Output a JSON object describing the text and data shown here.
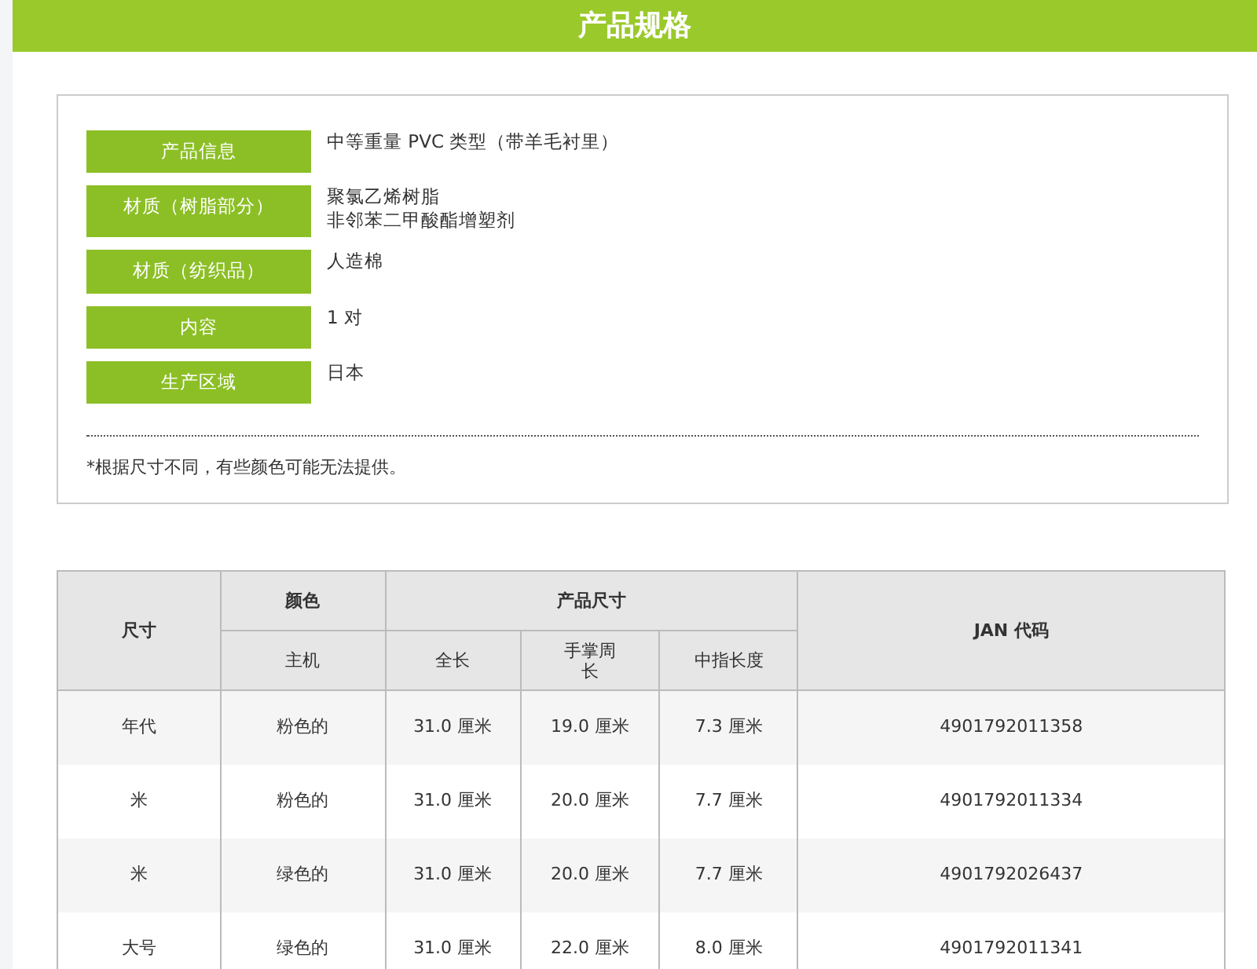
{
  "header": {
    "title": "产品规格"
  },
  "specs": [
    {
      "label": "产品信息",
      "lines": [
        "中等重量 PVC 类型（带羊毛衬里）"
      ]
    },
    {
      "label": "材质（树脂部分）",
      "lines": [
        "聚氯乙烯树脂",
        "非邻苯二甲酸酯增塑剂"
      ]
    },
    {
      "label": "材质（纺织品）",
      "lines": [
        "人造棉"
      ]
    },
    {
      "label": "内容",
      "lines": [
        "1 对"
      ]
    },
    {
      "label": "生产区域",
      "lines": [
        "日本"
      ]
    }
  ],
  "note": "*根据尺寸不同，有些颜色可能无法提供。",
  "table": {
    "groups": [
      {
        "label": "尺寸"
      },
      {
        "label": "颜色",
        "columns": [
          "主机"
        ]
      },
      {
        "label": "产品尺寸",
        "columns": [
          "全长",
          "手掌周长",
          "中指长度"
        ]
      },
      {
        "label": "JAN 代码"
      }
    ],
    "rows": [
      [
        "年代",
        "粉色的",
        "31.0 厘米",
        "19.0 厘米",
        "7.3 厘米",
        "4901792011358"
      ],
      [
        "米",
        "粉色的",
        "31.0 厘米",
        "20.0 厘米",
        "7.7 厘米",
        "4901792011334"
      ],
      [
        "米",
        "绿色的",
        "31.0 厘米",
        "20.0 厘米",
        "7.7 厘米",
        "4901792026437"
      ],
      [
        "大号",
        "绿色的",
        "31.0 厘米",
        "22.0 厘米",
        "8.0 厘米",
        "4901792011341"
      ]
    ]
  }
}
